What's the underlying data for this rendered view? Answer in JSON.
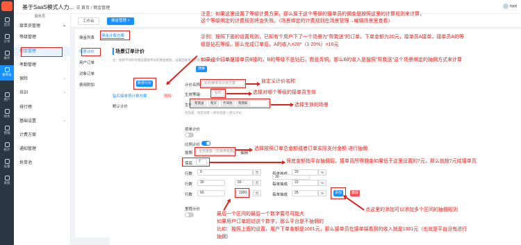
{
  "app": {
    "title": "基于SaaS模式人力...",
    "subtitle": "服务员"
  },
  "breadcrumb": {
    "home": "首页",
    "current": "佣金管理"
  },
  "user": {
    "name": "root"
  },
  "rail": [
    {
      "label": "首页"
    },
    {
      "label": "订单"
    },
    {
      "label": "服务"
    },
    {
      "label": "接单员"
    },
    {
      "label": "用户"
    },
    {
      "label": "财务"
    },
    {
      "label": "营销"
    },
    {
      "label": "统计"
    },
    {
      "label": "设置"
    },
    {
      "label": "系统"
    }
  ],
  "sidebar": [
    {
      "label": "接单员管理"
    },
    {
      "label": "等级管理"
    },
    {
      "label": "佣金管理"
    },
    {
      "label": "考勤管理"
    },
    {
      "label": "保险"
    },
    {
      "label": "培训"
    },
    {
      "label": "排行榜"
    },
    {
      "label": "基础设置"
    },
    {
      "label": "计费方案"
    },
    {
      "label": "通知管理"
    },
    {
      "label": "抢单池"
    }
  ],
  "tabs": {
    "workbench": "工作台",
    "active": "佣金管理"
  },
  "subnav": {
    "title": "佣金列表",
    "items": [
      "场景计价",
      "用户订单",
      "对象订单",
      "费用附加"
    ]
  },
  "scheme_tab": "佣金计费方案",
  "panel": {
    "title": "场景订单计价",
    "hint": "注：按照不同的场景设置接单员的佣金规则，设置后接单员在接单时，佣金按照规则计算",
    "search_btn": "搜索",
    "add_btn": "新增计价",
    "list_item": "钻石接单员计费方案",
    "list_del": "删除",
    "list_default": "默认计价"
  },
  "form": {
    "name_label": "计价名称:",
    "name_value": "钻石接单员计费方案",
    "level_label": "生效等级:",
    "level_value": "钻石",
    "scene_label": "生效场景:",
    "scene_tags": [
      "帮我送",
      "帮买",
      "代驾他",
      "帮我取"
    ],
    "scene_hint": "优先级：指定场景 > 所有场景 > 默认计价",
    "order_price_label": "按单计价",
    "ratio_label": "比例计价",
    "mode_prefix": "按照",
    "mode_value": "全部金额（优惠券金额）",
    "mode_suffix": "抽佣",
    "floor_label": "保底",
    "floor_value": "7",
    "rows": [
      {
        "k1": "0",
        "k2": "30",
        "k3": "20"
      },
      {
        "k1": "30",
        "k2": "60",
        "k3": "22"
      },
      {
        "k1": "60",
        "k2": "1000",
        "k3": "25"
      }
    ],
    "row_labels": {
      "a": "行数",
      "b": "元",
      "c": "每单抽成",
      "d": "%"
    },
    "add_row_btn": "添加",
    "del_row_btn": "删除",
    "mileage_label": "里程计价"
  },
  "notes": {
    "top1": "注意：如果这里设置了等级计费方案，那么属于这个等级的接单员的佣金是按照这里的计算规则来计算，",
    "top2": "这个等级绑定的计费规则将会失效。（场景绑定的计费规则在场景管理→编辑场景里查看）",
    "ex1": "示例：按照下面的设置规则，已知有个用户下了一个场景为\"帮我送\"的订单，下单金额为20元，接单员A接单，接单员A的等",
    "ex2": "级是钻石等级。那么完成订单后，A的收入=20*（1-20%）=16元",
    "ex3": "如果这个订单是接单员B接的，B的等级不是钻石，而是青铜。那么B的收入是按照\"帮我送\"这个场景绑定的抽佣方式来计算",
    "name": "自定义计价名称",
    "level": "选择对哪个等级的接单员生效",
    "scene": "选择生效的场景",
    "mode": "选择按照订单总金额或者订单实际支付金额  进行抽佣",
    "floor": "保底金额指平台抽佣后，接单员所得佣金如果低于这里设置的7元，那么就按7元给接单员",
    "add": "点这里的添加可以添加多个区间的抽佣规则",
    "b1": "最后一个区间的最后一个数字要尽可能大",
    "b2": "如果用户订单超过这个数字，那么平台是不抽佣的",
    "b3": "比如：按照上面的设置，用户下单金额是1001元，那么接单员在接单端看到的收入就是1001元（也就是平台没有进行",
    "b4": "抽佣）"
  },
  "colors": {
    "accent": "#1890ff",
    "annotation": "#e0201b",
    "rail": "#2b3643"
  }
}
